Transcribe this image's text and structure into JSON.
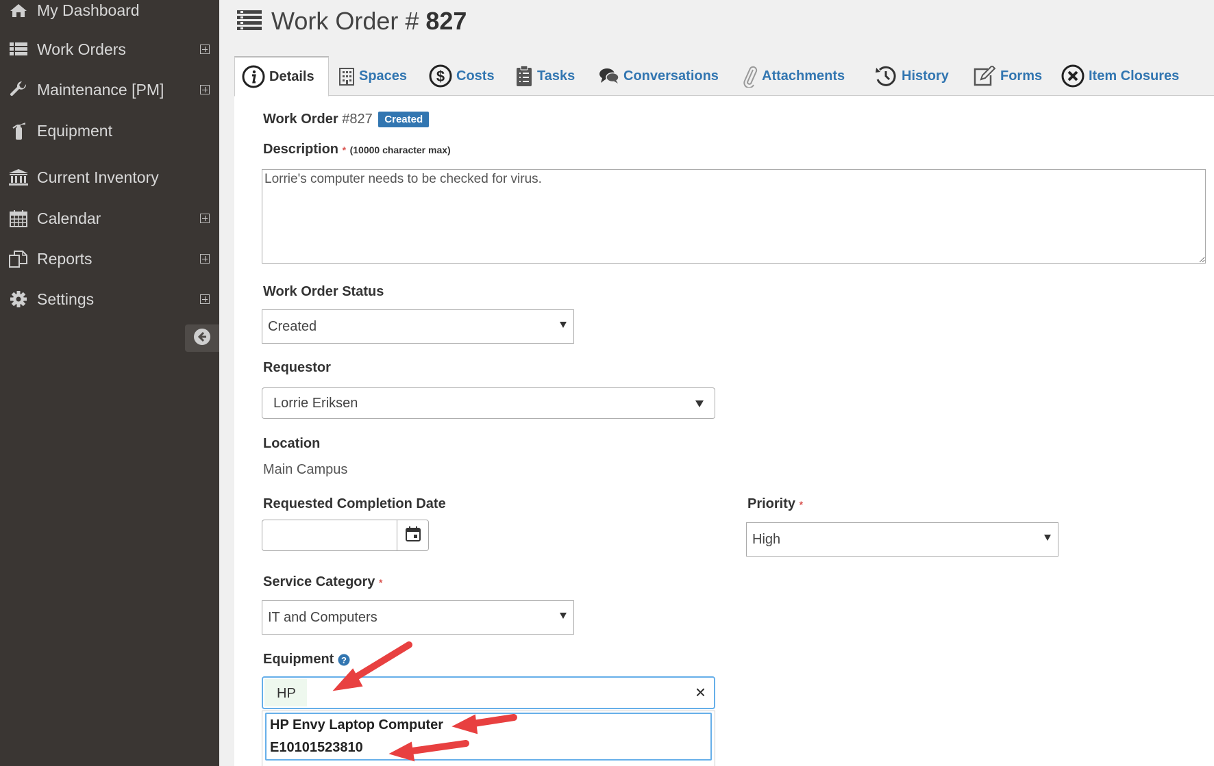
{
  "sidebar": {
    "items": [
      {
        "label": "My Dashboard",
        "icon": "home-icon",
        "expandable": false
      },
      {
        "label": "Work Orders",
        "icon": "list-icon",
        "expandable": true
      },
      {
        "label": "Maintenance [PM]",
        "icon": "wrench-icon",
        "expandable": true
      },
      {
        "label": "Equipment",
        "icon": "fire-extinguisher-icon",
        "expandable": false
      },
      {
        "label": "Current Inventory",
        "icon": "bank-icon",
        "expandable": false
      },
      {
        "label": "Calendar",
        "icon": "calendar-icon",
        "expandable": true
      },
      {
        "label": "Reports",
        "icon": "reports-icon",
        "expandable": true
      },
      {
        "label": "Settings",
        "icon": "gear-icon",
        "expandable": true
      }
    ]
  },
  "header": {
    "title_prefix": "Work Order # ",
    "title_number": "827"
  },
  "tabs": [
    {
      "label": "Details",
      "icon": "info-icon",
      "active": true
    },
    {
      "label": "Spaces",
      "icon": "building-icon"
    },
    {
      "label": "Costs",
      "icon": "dollar-icon"
    },
    {
      "label": "Tasks",
      "icon": "clipboard-icon"
    },
    {
      "label": "Conversations",
      "icon": "chat-icon"
    },
    {
      "label": "Attachments",
      "icon": "paperclip-icon"
    },
    {
      "label": "History",
      "icon": "history-icon"
    },
    {
      "label": "Forms",
      "icon": "edit-icon"
    },
    {
      "label": "Item Closures",
      "icon": "close-circle-icon"
    }
  ],
  "form": {
    "wo_label": "Work Order",
    "wo_number": "#827",
    "status_badge": "Created",
    "description_label": "Description",
    "description_note": "(10000 character max)",
    "description_value": "Lorrie's computer needs to be checked for virus.",
    "status_label": "Work Order Status",
    "status_value": "Created",
    "requestor_label": "Requestor",
    "requestor_value": "Lorrie Eriksen",
    "location_label": "Location",
    "location_value": "Main Campus",
    "completion_label": "Requested Completion Date",
    "completion_value": "",
    "priority_label": "Priority",
    "priority_value": "High",
    "category_label": "Service Category",
    "category_value": "IT and Computers",
    "equipment_label": "Equipment",
    "equipment_value": "HP",
    "clear": "×",
    "asterisk": "*",
    "suggestions": [
      "HP Envy Laptop Computer",
      "E10101523810"
    ]
  },
  "colors": {
    "sidebar": "#3a3633",
    "link": "#3276b1",
    "badge": "#3276b1",
    "required": "#d9534f",
    "arrow": "#e84040"
  }
}
